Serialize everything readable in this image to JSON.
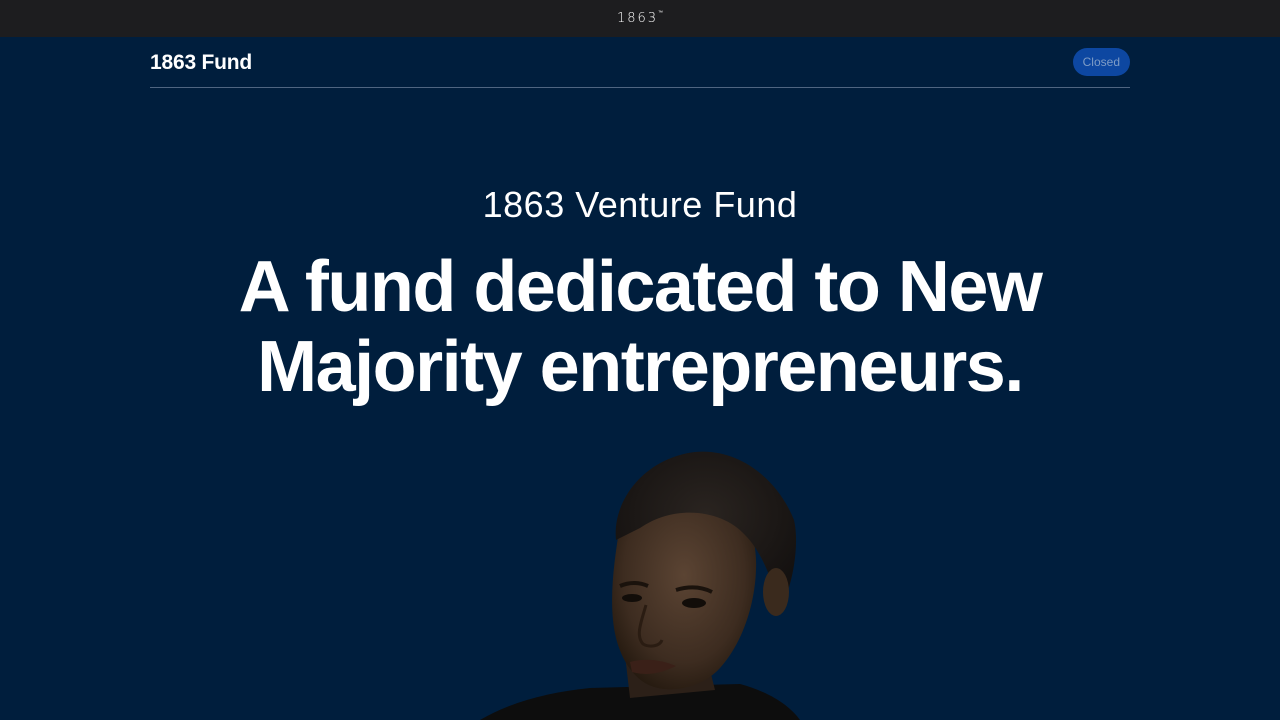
{
  "global_nav": {
    "logo_text": "1863",
    "logo_mark": "™"
  },
  "subnav": {
    "title": "1863 Fund",
    "status": "Closed"
  },
  "hero": {
    "eyebrow": "1863 Venture Fund",
    "headline": "A fund dedicated to New Majority entrepreneurs.",
    "image_icon": "portrait-photo"
  },
  "colors": {
    "background": "#001e3d",
    "topbar": "#1d1d1f",
    "badge": "#0d47a1",
    "badge_text": "#7e9cc6",
    "text": "#ffffff"
  }
}
